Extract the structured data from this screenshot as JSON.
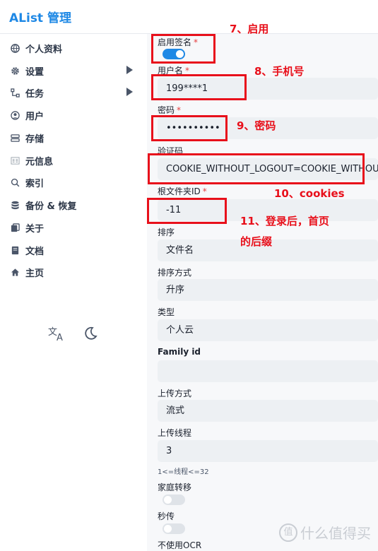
{
  "app": {
    "brand": "AList 管理"
  },
  "sidebar": {
    "items": [
      {
        "label": "个人资料",
        "icon": "globe-icon"
      },
      {
        "label": "设置",
        "icon": "gear-icon"
      },
      {
        "label": "任务",
        "icon": "task-icon"
      },
      {
        "label": "用户",
        "icon": "user-icon"
      },
      {
        "label": "存储",
        "icon": "storage-icon"
      },
      {
        "label": "元信息",
        "icon": "meta-icon"
      },
      {
        "label": "索引",
        "icon": "search-icon"
      },
      {
        "label": "备份 & 恢复",
        "icon": "database-icon"
      },
      {
        "label": "关于",
        "icon": "about-icon"
      },
      {
        "label": "文档",
        "icon": "book-icon"
      },
      {
        "label": "主页",
        "icon": "home-icon"
      }
    ]
  },
  "form": {
    "enable_sign_label": "启用签名",
    "enable_sign_on": true,
    "username_label": "用户名",
    "username_value": "199****1",
    "password_label": "密码",
    "password_value": "••••••••••",
    "captcha_label": "验证码",
    "captcha_value": "COOKIE_WITHOUT_LOGOUT=COOKIE_WITHOUT_LOGOUT",
    "root_folder_label": "根文件夹ID",
    "root_folder_value": "-11",
    "order_by_label": "排序",
    "order_by_value": "文件名",
    "order_direction_label": "排序方式",
    "order_direction_value": "升序",
    "type_label": "类型",
    "type_value": "个人云",
    "family_id_label": "Family id",
    "family_id_value": "",
    "upload_method_label": "上传方式",
    "upload_method_value": "流式",
    "upload_threads_label": "上传线程",
    "upload_threads_value": "3",
    "upload_threads_hint": "1<=线程<=32",
    "family_transfer_label": "家庭转移",
    "family_transfer_on": false,
    "rapid_upload_label": "秒传",
    "rapid_upload_on": false,
    "no_ocr_label": "不使用OCR",
    "required_mark": "*"
  },
  "annotations": {
    "a7": "7、启用",
    "a8": "8、手机号",
    "a9": "9、密码",
    "a10": "10、cookies",
    "a11_line1": "11、登录后，首页",
    "a11_line2": "的后缀",
    "color": "#e8101b"
  },
  "watermark": {
    "text": "什么值得买",
    "logo": "值"
  },
  "colors": {
    "accent": "#1e88e5",
    "required": "#e53e3e"
  }
}
